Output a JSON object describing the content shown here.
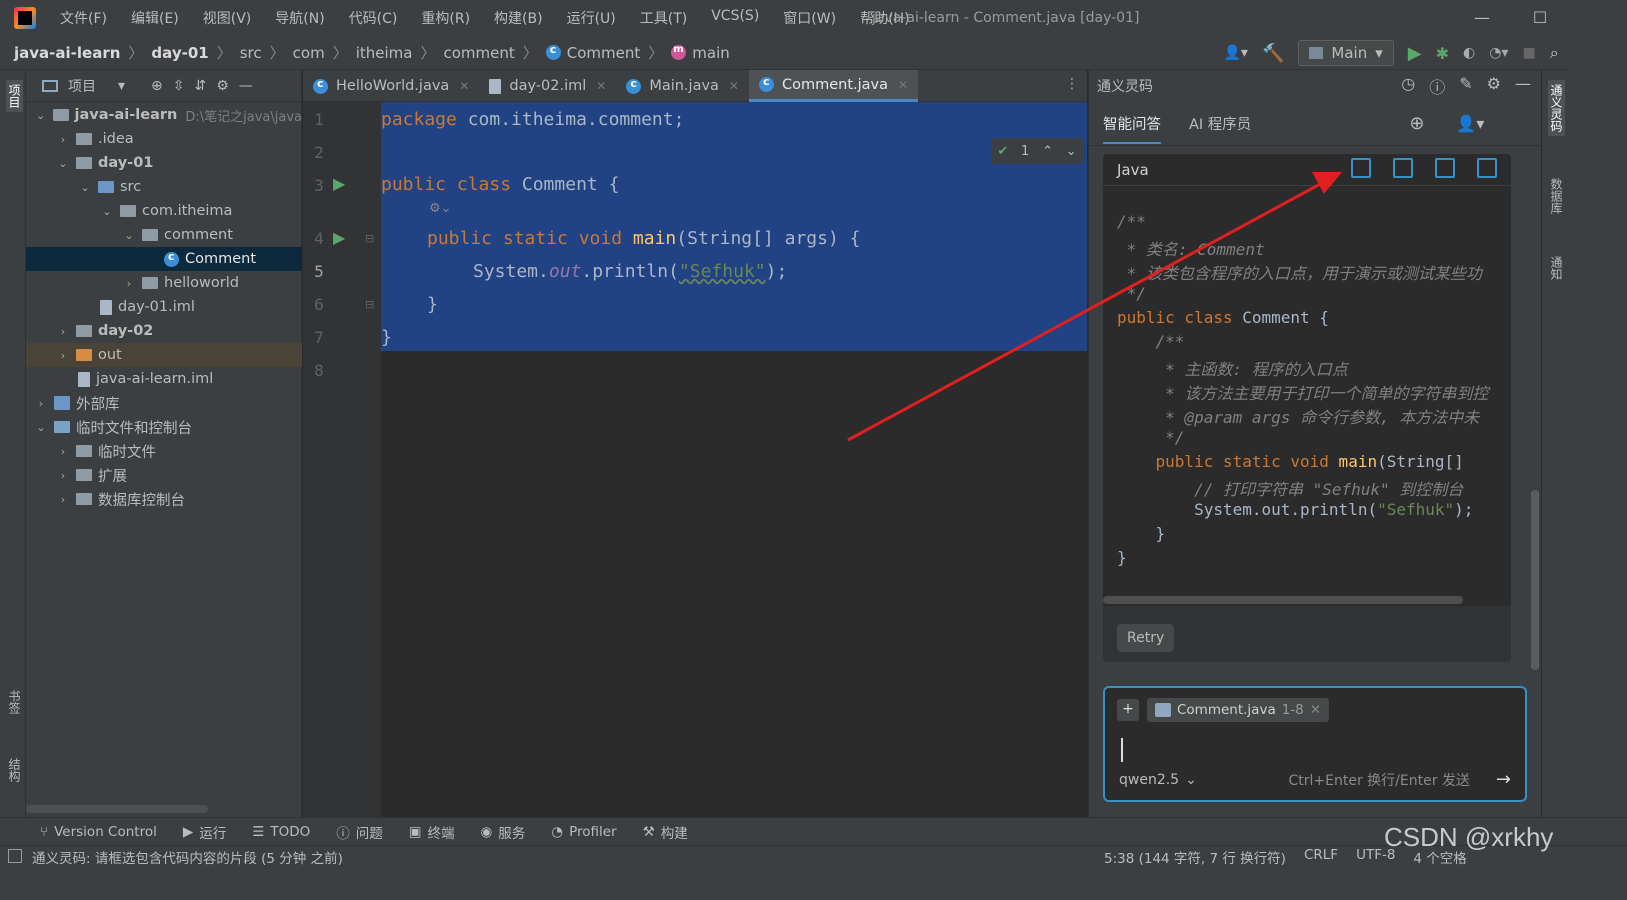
{
  "window": {
    "title": "java-ai-learn - Comment.java [day-01]"
  },
  "menu": [
    "文件(F)",
    "编辑(E)",
    "视图(V)",
    "导航(N)",
    "代码(C)",
    "重构(R)",
    "构建(B)",
    "运行(U)",
    "工具(T)",
    "VCS(S)",
    "窗口(W)",
    "帮助(H)"
  ],
  "breadcrumb": {
    "project": "java-ai-learn",
    "module": "day-01",
    "p1": "src",
    "p2": "com",
    "p3": "itheima",
    "p4": "comment",
    "cls": "Comment",
    "method": "main"
  },
  "runconfig": "Main",
  "project_panel": {
    "title": "项目",
    "items": [
      {
        "label": "java-ai-learn",
        "hint": "D:\\笔记之java\\java"
      },
      {
        "label": ".idea"
      },
      {
        "label": "day-01"
      },
      {
        "label": "src"
      },
      {
        "label": "com.itheima"
      },
      {
        "label": "comment"
      },
      {
        "label": "Comment"
      },
      {
        "label": "helloworld"
      },
      {
        "label": "day-01.iml"
      },
      {
        "label": "day-02"
      },
      {
        "label": "out"
      },
      {
        "label": "java-ai-learn.iml"
      },
      {
        "label": "外部库"
      },
      {
        "label": "临时文件和控制台"
      },
      {
        "label": "临时文件"
      },
      {
        "label": "扩展"
      },
      {
        "label": "数据库控制台"
      }
    ]
  },
  "left_stripe": {
    "top": "项目",
    "bookmark": "书签",
    "structure": "结构"
  },
  "tabs": [
    {
      "label": "HelloWorld.java"
    },
    {
      "label": "day-02.iml"
    },
    {
      "label": "Main.java"
    },
    {
      "label": "Comment.java"
    }
  ],
  "editor": {
    "line_numbers": [
      "1",
      "2",
      "3",
      "4",
      "5",
      "6",
      "7",
      "8"
    ],
    "inspections": "1",
    "code": {
      "l1_kw": "package",
      "l1_rest": " com.itheima.comment;",
      "l3_kw": "public class",
      "l3_rest": " Comment {",
      "l4_kw": "public static void",
      "l4_fn": " main",
      "l4_rest": "(String[] args) {",
      "l5_a": "System.",
      "l5_fld": "out",
      "l5_b": ".println(",
      "l5_str": "\"Sefhuk\"",
      "l5_c": ");",
      "l6": "}",
      "l7": "}"
    }
  },
  "ai_panel": {
    "title": "通义灵码",
    "tab1": "智能问答",
    "tab2": "AI 程序员",
    "lang": "Java",
    "code": {
      "a1": "/**",
      "a2": " * 类名: Comment",
      "a3": " * 该类包含程序的入口点，用于演示或测试某些功",
      "a4": " */",
      "a5_kw": "public class",
      "a5_rest": " Comment {",
      "a6": "    /**",
      "a7": "     * 主函数: 程序的入口点",
      "a8": "     * 该方法主要用于打印一个简单的字符串到控",
      "a9": "     * @param args 命令行参数, 本方法中未",
      "a10": "     */",
      "a11_kw": "    public static void",
      "a11_fn": " main",
      "a11_rest": "(String[]",
      "a12": "        // 打印字符串 \"Sefhuk\" 到控制台",
      "a13_a": "        System.out.println(",
      "a13_str": "\"Sefhuk\"",
      "a13_b": ");",
      "a14": "    }",
      "a15": "}"
    },
    "retry": "Retry",
    "context_chip": "Comment.java",
    "context_range": "1-8",
    "model": "qwen2.5",
    "send_hint": "Ctrl+Enter 换行/Enter 发送"
  },
  "right_stripe": {
    "a": "通义灵码",
    "b": "数据库",
    "c": "通知"
  },
  "toolwindows": [
    "Version Control",
    "运行",
    "TODO",
    "问题",
    "终端",
    "服务",
    "Profiler",
    "构建"
  ],
  "status": {
    "message": "通义灵码: 请框选包含代码内容的片段 (5 分钟 之前)",
    "position": "5:38 (144 字符, 7 行 换行符)",
    "line_sep": "CRLF",
    "encoding": "UTF-8",
    "indent": "4 个空格"
  },
  "watermark": "CSDN @xrkhy",
  "colors": {
    "selection": "#214283",
    "accent": "#3592c4",
    "arrow": "#e0201f"
  }
}
